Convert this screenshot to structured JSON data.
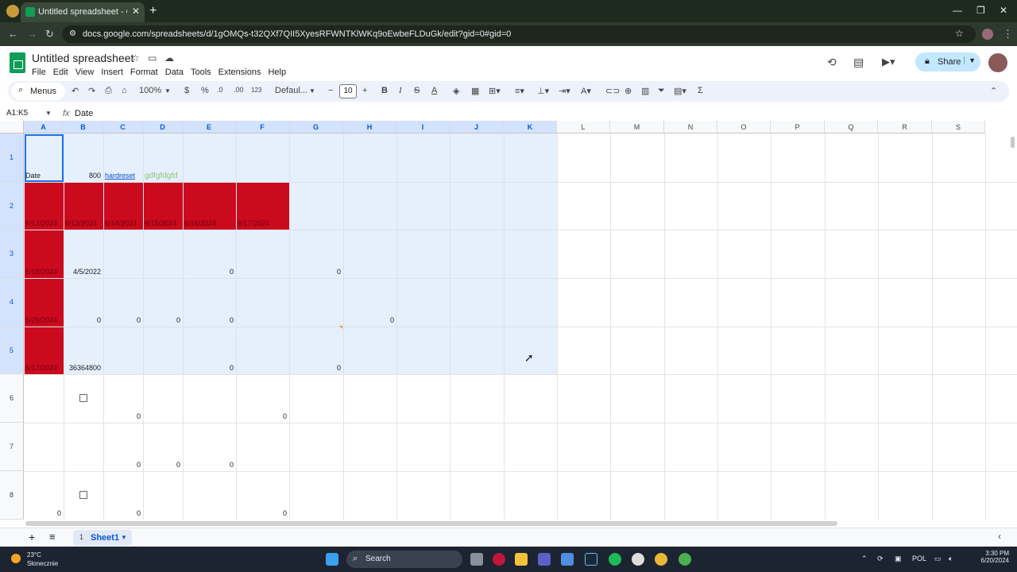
{
  "browser": {
    "tab_title": "Untitled spreadsheet - Google S",
    "url": "docs.google.com/spreadsheets/d/1gOMQs-t32QXf7QII5XyesRFWNTKlWKq9oEwbeFLDuGk/edit?gid=0#gid=0"
  },
  "doc": {
    "title": "Untitled spreadsheet",
    "menu": [
      "File",
      "Edit",
      "View",
      "Insert",
      "Format",
      "Data",
      "Tools",
      "Extensions",
      "Help"
    ],
    "share_label": "Share"
  },
  "toolbar": {
    "menus_label": "Menus",
    "zoom": "100%",
    "currency": "$",
    "percent": "%",
    "dec_decrease": ".0",
    "dec_increase": ".00",
    "format_123": "123",
    "font": "Defaul...",
    "font_size": "10"
  },
  "formula_bar": {
    "name_box": "A1:K5",
    "fx": "fx",
    "content": "Date"
  },
  "grid": {
    "columns": [
      "A",
      "B",
      "C",
      "D",
      "E",
      "F",
      "G",
      "H",
      "I",
      "J",
      "K",
      "L",
      "M",
      "N",
      "O",
      "P",
      "Q",
      "R",
      "S"
    ],
    "rows": [
      "1",
      "2",
      "3",
      "4",
      "5",
      "6",
      "7",
      "8"
    ],
    "cells": {
      "A1": "Date",
      "B1": "800",
      "C1": "hardreset",
      "D1": "gdfgfdgfd",
      "A2": "6/12/2024",
      "B2": "6/13/2024",
      "C2": "6/14/2024",
      "D2": "6/15/2024",
      "E2": "6/16/2024",
      "F2": "6/17/2024",
      "A3": "6/18/2024",
      "B3": "4/5/2022",
      "E3": "0",
      "G3": "0",
      "A4": "5/29/2024",
      "B4": "0",
      "C4": "0",
      "D4": "0",
      "E4": "0",
      "H4": "0",
      "A5": "6/17/2024",
      "B5": "36364800",
      "E5": "0",
      "G5": "0",
      "C6": "0",
      "F6": "0",
      "C7": "0",
      "D7": "0",
      "E7": "0",
      "A8": "0",
      "C8": "0",
      "F8": "0"
    }
  },
  "sheets": {
    "count": "1",
    "active": "Sheet1"
  },
  "taskbar": {
    "temp": "23°C",
    "condition": "Słonecznie",
    "search": "Search",
    "lang": "POL",
    "time": "3:30 PM",
    "date": "6/20/2024"
  },
  "colors": {
    "accent": "#1a73e8",
    "fill_red": "#cc0a1d",
    "selection": "#d3e3fd"
  }
}
